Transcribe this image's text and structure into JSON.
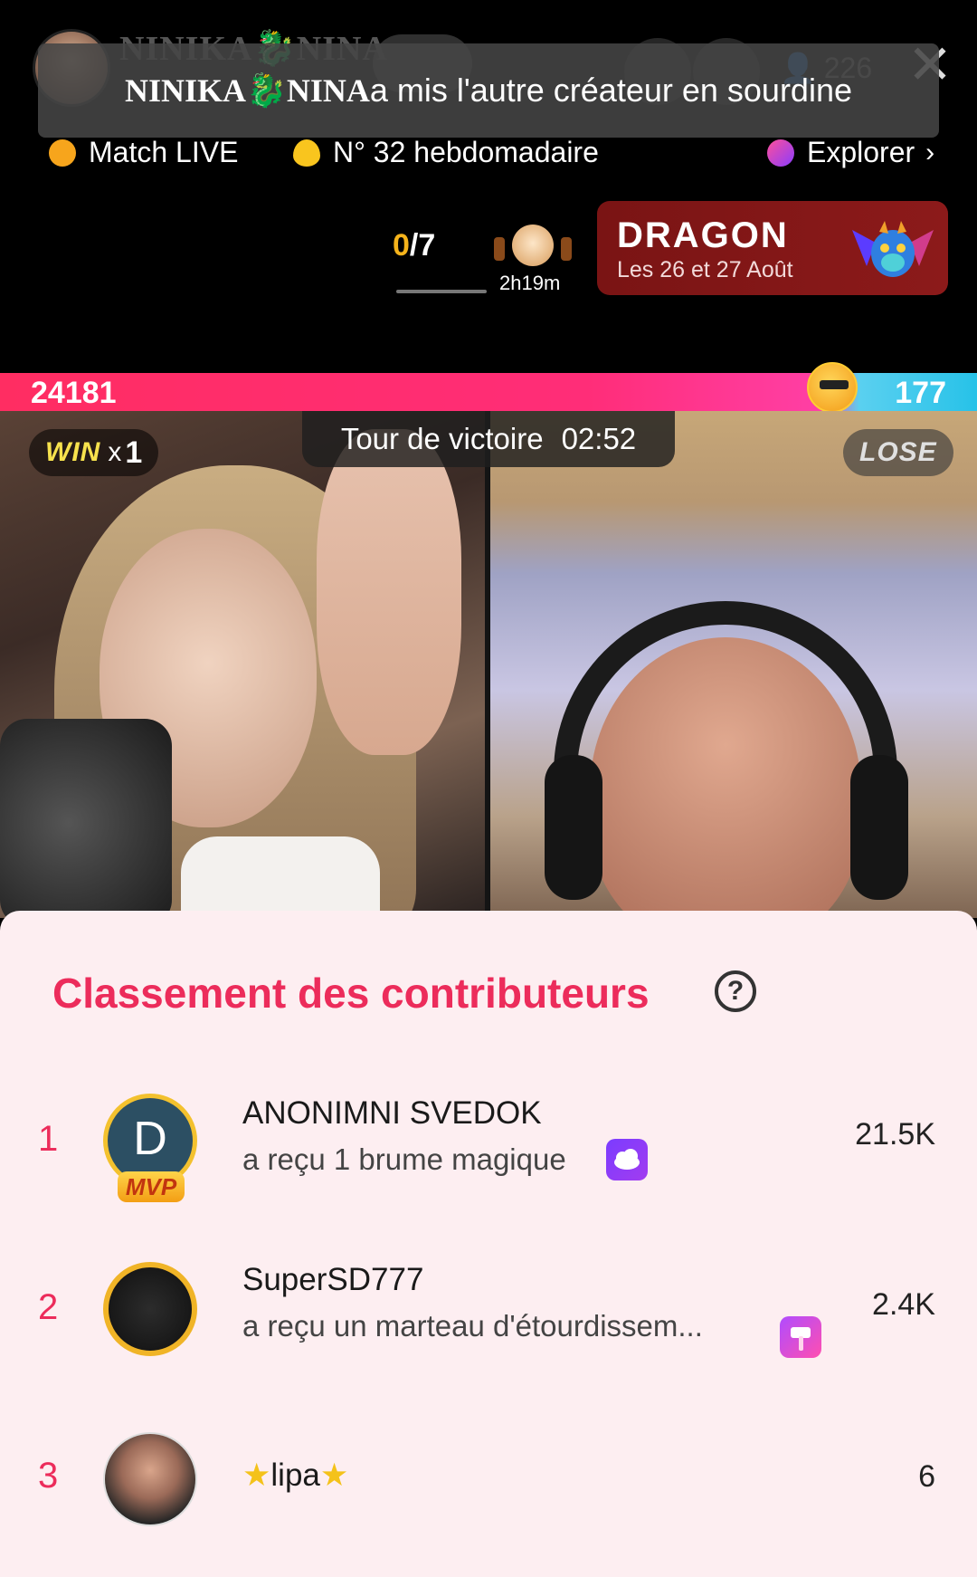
{
  "header": {
    "host_name_ghost": "NINIKA🐉NINA",
    "viewer_count": "226",
    "toast": {
      "host_name": "NINIKA🐉NINA",
      "message": " a mis l'autre créateur en sourdine"
    },
    "chips": [
      {
        "label": "Match LIVE",
        "icon": "match-icon"
      },
      {
        "label": "N° 32 hebdomadaire",
        "icon": "flame-icon"
      },
      {
        "label": "Explorer",
        "icon": "planet-icon"
      }
    ],
    "goal": {
      "current": "0",
      "total": "/7",
      "progress": 0
    },
    "gift_timer": "2h19m",
    "event": {
      "title": "DRAGON",
      "subtitle": "Les 26 et 27 Août",
      "icon": "dragon-icon"
    }
  },
  "battle": {
    "score_left": "24181",
    "score_right": "177",
    "win_label": "WIN",
    "win_multiplier_x": "x",
    "win_multiplier_n": "1",
    "lose_label": "LOSE",
    "round_label": "Tour de victoire",
    "round_time": "02:52",
    "colors": {
      "left": "#ff2d62",
      "right": "#27c2e8"
    }
  },
  "contributors": {
    "title": "Classement des contributeurs",
    "help_icon": "?",
    "rows": [
      {
        "rank": "1",
        "avatar_letter": "D",
        "badge": "MVP",
        "name": "ANONIMNI SVEDOK",
        "gift": "a reçu 1 brume magique",
        "gift_icon": "cloud-icon",
        "score": "21.5K"
      },
      {
        "rank": "2",
        "name": "SuperSD777",
        "gift": "a reçu un marteau d'étourdissem...",
        "gift_icon": "hammer-icon",
        "score": "2.4K"
      },
      {
        "rank": "3",
        "name_star_left": "★",
        "name": "lipa",
        "name_star_right": "★",
        "score": "6"
      }
    ]
  },
  "accent_color": "#ec2c5b"
}
